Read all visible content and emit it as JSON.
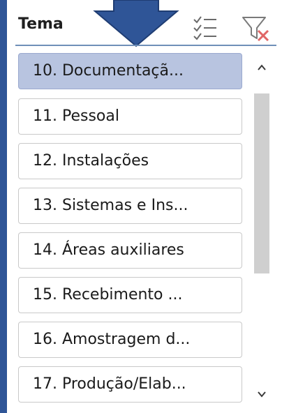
{
  "slicer": {
    "title": "Tema",
    "icons": {
      "multiselect": "multi-select-icon",
      "clear_filter": "clear-filter-icon",
      "annotation": "down-arrow-icon"
    },
    "colors": {
      "frame": "#2f5597",
      "selected_item": "#b8c4e0",
      "arrow": "#2f5597",
      "clear_x": "#e06666"
    },
    "items": [
      {
        "label": "10. Documentaçã...",
        "selected": true
      },
      {
        "label": "11. Pessoal",
        "selected": false
      },
      {
        "label": "12. Instalações",
        "selected": false
      },
      {
        "label": "13. Sistemas e Ins...",
        "selected": false
      },
      {
        "label": "14. Áreas auxiliares",
        "selected": false
      },
      {
        "label": "15. Recebimento ...",
        "selected": false
      },
      {
        "label": "16. Amostragem d...",
        "selected": false
      },
      {
        "label": "17. Produção/Elab...",
        "selected": false
      }
    ]
  }
}
